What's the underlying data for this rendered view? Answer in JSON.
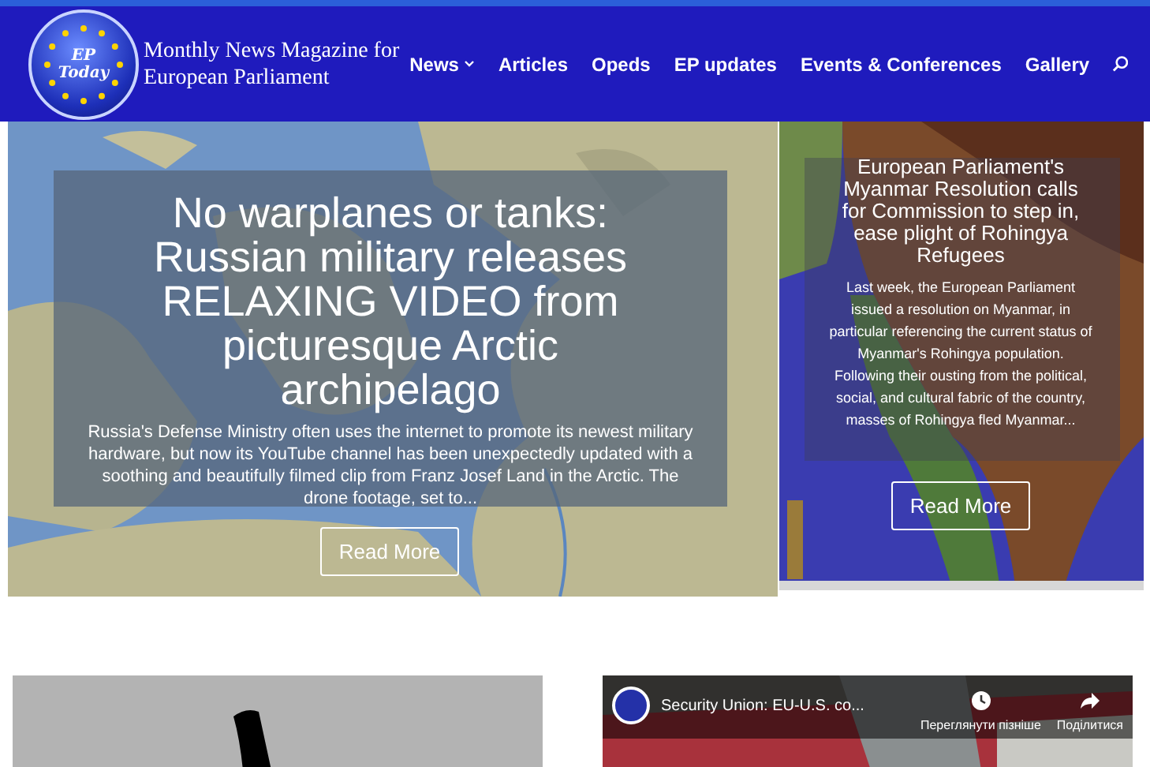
{
  "header": {
    "logo": {
      "line_1": "EP",
      "line_2": "Today"
    },
    "tagline": "Monthly News Magazine for European Parliament",
    "nav": [
      {
        "label": "News",
        "dropdown": true
      },
      {
        "label": "Articles",
        "dropdown": false
      },
      {
        "label": "Opeds",
        "dropdown": false
      },
      {
        "label": "EP updates",
        "dropdown": false
      },
      {
        "label": "Events & Conferences",
        "dropdown": false
      },
      {
        "label": "Gallery",
        "dropdown": false
      }
    ]
  },
  "slides": [
    {
      "title": "No warplanes or tanks: Russian military releases RELAXING VIDEO from picturesque Arctic archipelago",
      "excerpt": "Russia's Defense Ministry often uses the internet to promote its newest military hardware, but now its YouTube channel has been unexpectedly updated with a soothing and beautifully filmed clip from Franz Josef Land in the Arctic. The drone footage, set to...",
      "button": "Read More"
    },
    {
      "title": "European Parliament's Myanmar Resolution calls for Commission to step in, ease plight of Rohingya Refugees",
      "excerpt": "Last week, the European Parliament issued a resolution on Myanmar, in particular referencing the current status of Myanmar's Rohingya population. Following their ousting from the political, social, and cultural fabric of the country, masses of Rohingya fled Myanmar...",
      "button": "Read More"
    }
  ],
  "video": {
    "title": "Security Union: EU-U.S. co...",
    "actions": [
      {
        "kind": "watch_later",
        "label": "Переглянути пізніше"
      },
      {
        "kind": "share",
        "label": "Поділитися"
      }
    ]
  }
}
